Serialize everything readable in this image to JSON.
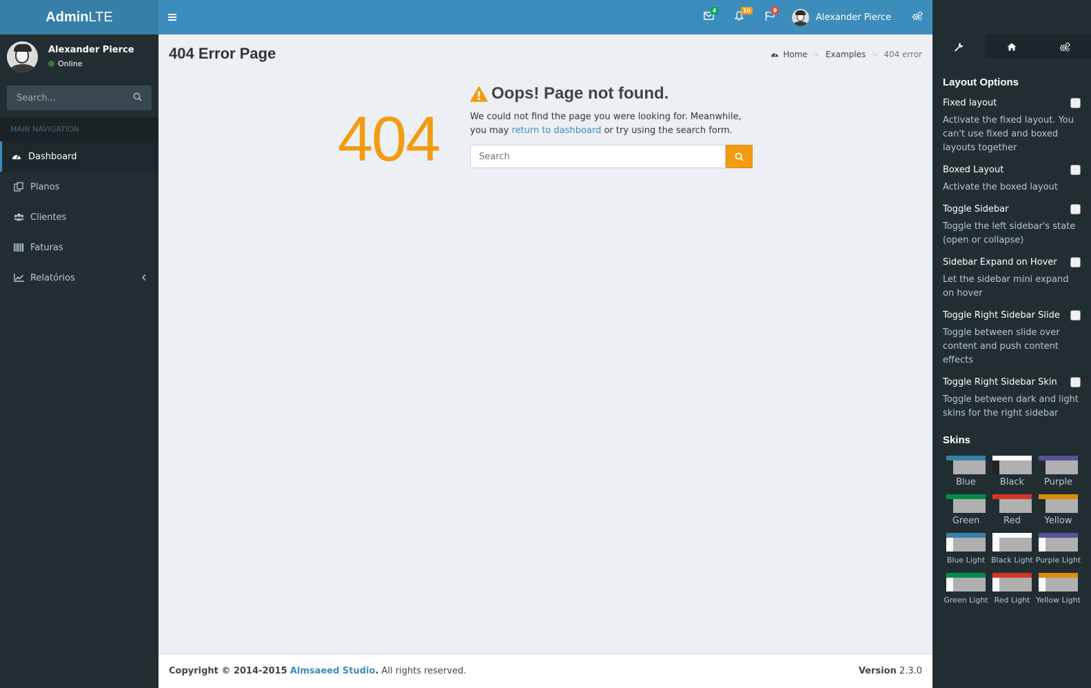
{
  "logo": {
    "bold": "Admin",
    "light": "LTE"
  },
  "user": {
    "name": "Alexander Pierce",
    "status": "Online"
  },
  "sidebar": {
    "search_placeholder": "Search...",
    "nav_header": "MAIN NAVIGATION",
    "items": [
      {
        "label": "Dashboard",
        "icon": "dashboard-icon"
      },
      {
        "label": "Planos",
        "icon": "copy-icon"
      },
      {
        "label": "Clientes",
        "icon": "users-icon"
      },
      {
        "label": "Faturas",
        "icon": "barcode-icon"
      },
      {
        "label": "Relatórios",
        "icon": "line-chart-icon"
      }
    ]
  },
  "navbar": {
    "messages_count": "4",
    "notifications_count": "10",
    "tasks_count": "9",
    "user_name": "Alexander Pierce",
    "colors": {
      "messages": "#00a65a",
      "notifications": "#f39c12",
      "tasks": "#dd4b39"
    }
  },
  "content": {
    "page_title": "404 Error Page",
    "breadcrumb": {
      "home": "Home",
      "examples": "Examples",
      "current": "404 error"
    },
    "error_code": "404",
    "error_title": "Oops! Page not found.",
    "error_text_before": "We could not find the page you were looking for. Meanwhile, you may",
    "error_link": "return to dashboard",
    "error_text_after": "or try using the search form.",
    "search_placeholder": "Search"
  },
  "footer": {
    "copyright": "Copyright © 2014-2015",
    "studio": "Almsaeed Studio",
    "rights": "All rights reserved.",
    "version_label": "Version",
    "version": "2.3.0"
  },
  "control_sidebar": {
    "layout_heading": "Layout Options",
    "options": [
      {
        "title": "Fixed layout",
        "desc": "Activate the fixed layout. You can't use fixed and boxed layouts together"
      },
      {
        "title": "Boxed Layout",
        "desc": "Activate the boxed layout"
      },
      {
        "title": "Toggle Sidebar",
        "desc": "Toggle the left sidebar's state (open or collapse)"
      },
      {
        "title": "Sidebar Expand on Hover",
        "desc": "Let the sidebar mini expand on hover"
      },
      {
        "title": "Toggle Right Sidebar Slide",
        "desc": "Toggle between slide over content and push content effects"
      },
      {
        "title": "Toggle Right Sidebar Skin",
        "desc": "Toggle between dark and light skins for the right sidebar"
      }
    ],
    "skins_heading": "Skins",
    "skins": [
      {
        "label": "Blue",
        "top": "#367fa9",
        "side": "#222d32"
      },
      {
        "label": "Black",
        "top": "#fefefe",
        "side": "#222"
      },
      {
        "label": "Purple",
        "top": "#555299",
        "side": "#222d32"
      },
      {
        "label": "Green",
        "top": "#008d4c",
        "side": "#222d32"
      },
      {
        "label": "Red",
        "top": "#d33724",
        "side": "#222d32"
      },
      {
        "label": "Yellow",
        "top": "#db8b0b",
        "side": "#222d32"
      },
      {
        "label": "Blue Light",
        "top": "#367fa9",
        "side": "#f9fafc"
      },
      {
        "label": "Black Light",
        "top": "#fefefe",
        "side": "#f9fafc"
      },
      {
        "label": "Purple Light",
        "top": "#555299",
        "side": "#f9fafc"
      },
      {
        "label": "Green Light",
        "top": "#008d4c",
        "side": "#f9fafc"
      },
      {
        "label": "Red Light",
        "top": "#d33724",
        "side": "#f9fafc"
      },
      {
        "label": "Yellow Light",
        "top": "#db8b0b",
        "side": "#f9fafc"
      }
    ]
  }
}
